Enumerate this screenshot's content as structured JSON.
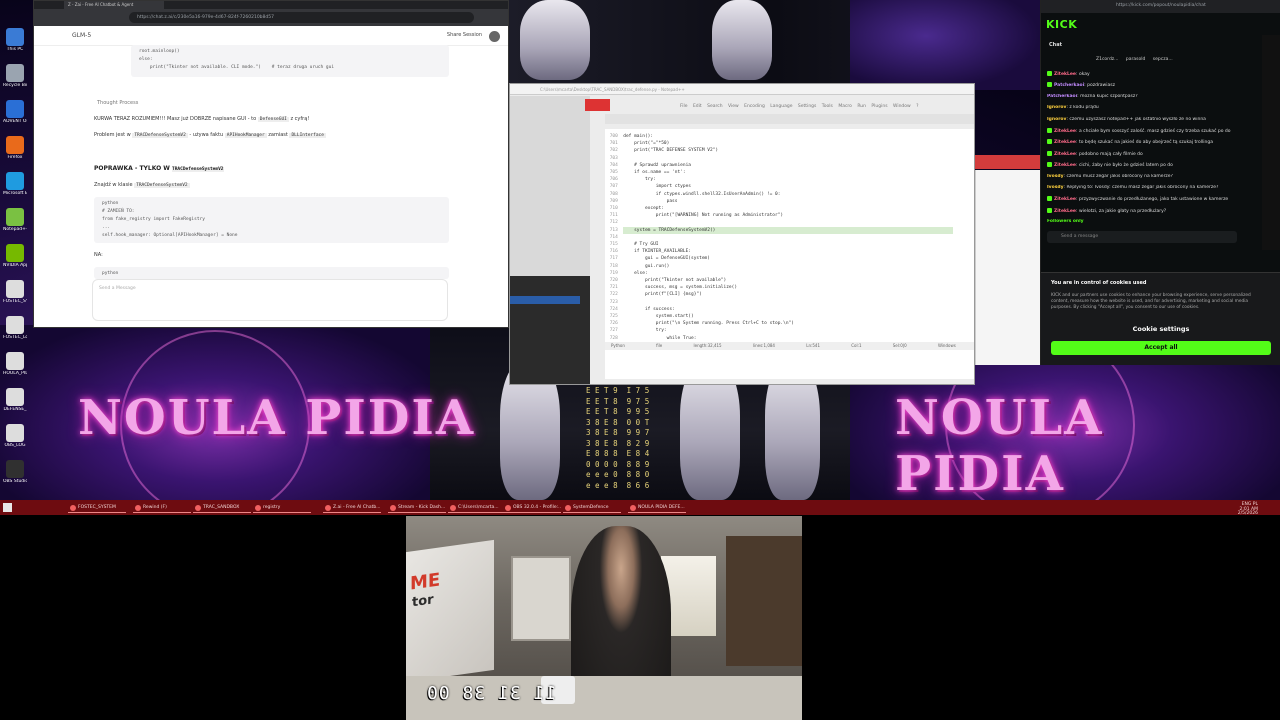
{
  "desktop": {
    "wallpaper_text": "NOULA PIDIA",
    "icons": [
      {
        "label": "This PC",
        "color": "#3a7bd5"
      },
      {
        "label": "Recycle Bin",
        "color": "#9aa4b0"
      },
      {
        "label": "ADVENT Oracle",
        "color": "#2a6fd6"
      },
      {
        "label": "Firefox",
        "color": "#e96a1b"
      },
      {
        "label": "Microsoft Edge",
        "color": "#1f9be0"
      },
      {
        "label": "Notepad++",
        "color": "#7ac142"
      },
      {
        "label": "NVIDIA App",
        "color": "#76b900"
      },
      {
        "label": "FOSTEC_SYSTEM",
        "color": "#dddddd"
      },
      {
        "label": "FOSTEC_Log",
        "color": "#dddddd"
      },
      {
        "label": "HOULA_PIDIA",
        "color": "#dddddd"
      },
      {
        "label": "DEFENSE_",
        "color": "#dddddd"
      },
      {
        "label": "OBS_LOG",
        "color": "#dddddd"
      },
      {
        "label": "OBS Studio",
        "color": "#303030"
      }
    ],
    "digit_stream": "E E T 9  I 7 5 3\nE E T 8  9 7 5 3\nE E T 8  9 9 5 3\n3 8 E 8  0 0 T 5\n3 8 E 8  9 9 7 3\n3 8 E 8  8 2 9 9\nE 8 8 8  E 8 4 8\n0 0 0 0  8 8 9 9\ne e e 0  8 8 0 9\ne e e 8  8 6 6 6"
  },
  "browser": {
    "tab_title": "Z - Zai - Free AI Chatbot & Agent",
    "url": "https://chat.z.ai/c/230e5a16-979e-4d67-824f-7260210b8d57",
    "app_name": "GLM-5",
    "share_label": "Share Session",
    "code_top": "root.mainloop()\nelse:\n    print(\"Tkinter not available. CLI mode.\")    # teraz druga uruch gui",
    "thought_label": "Thought Process",
    "line_1": "KURWA TERAZ ROZUMIEM!!! Masz już DOBRZE napisane GUI - to",
    "line_1_code": "DefenseGUI",
    "line_1_tail": "z cyfrą!",
    "line_2": "Problem jest w",
    "line_2_code": "TRACDefenseSystemV2",
    "line_2_mid": "- używa faktu",
    "line_2_code2": "APIHookManager",
    "line_2_mid2": "zamiast",
    "line_2_code3": "DLLInterface",
    "heading": "POPRAWKA - TYLKO W",
    "heading_code": "TRACDefenseSystemV2",
    "find_text": "Znajdź w klasie",
    "find_code": "TRACDefenseSystemV2",
    "code_block": "python\n# ZAMIEŃ TO:\nfrom fake_registry import FakeRegistry\n...\nself.hook_manager: Optional[APIHookManager] = None",
    "na_text": "NA:",
    "code_block2_lang": "python",
    "input_placeholder": "Send a Message"
  },
  "editor": {
    "title": "C:\\Users\\mcarta\\Desktop\\TRAC_SANDBOX\\trac_defense.py - Notepad++",
    "menu": "File Edit Search View Encoding Language Settings Tools Macro Run Plugins Window ?",
    "code": "def main():\n    print(\"=\"*50)\n    print(\"TRAC DEFENSE SYSTEM V2\")\n    \n    # Sprawdź uprawnienia\n    if os.name == 'nt':\n        try:\n            import ctypes\n            if ctypes.windll.shell32.IsUserAnAdmin() != 0:\n                pass\n        except:\n            print(\"[WARNING] Not running as Administrator\")\n    \n    system = TRACDefenseSystemV2()\n    \n    # Try GUI\n    if TKINTER_AVAILABLE:\n        gui = DefenseGUI(system)\n        gui.run()\n    else:\n        print(\"Tkinter not available\")\n        success, msg = system.initialize()\n        print(f\"[CLI] {msg}\")\n        \n        if success:\n            system.start()\n            print(\"\\n System running. Press Ctrl+C to stop.\\n\")\n            try:\n                while True:\n                    time.sleep(1)",
    "status": "Python file   length:32,415  lines:1,084   Ln:541  Col:1  Sel:0|0   Windows (CR LF)   UTF-8   INS"
  },
  "kick": {
    "url": "https://kick.com/popout/noulapidia/chat",
    "logo": "KICK",
    "chat_title": "Chat",
    "pinned": [
      "Z1cordz...",
      "parasold",
      "sepcza..."
    ],
    "messages": [
      {
        "user": "ZitekLee",
        "text": "okay",
        "color": "red",
        "badge": true
      },
      {
        "user": "Patcherkaoi",
        "text": "pozdrawiasz",
        "color": "purple",
        "badge": true
      },
      {
        "user": "Patcherkaoi",
        "text": "można kupić szpontpasz?",
        "color": "purple",
        "badge": false
      },
      {
        "user": "Ignorov",
        "text": "z kodu prądu",
        "color": "yellow",
        "badge": false
      },
      {
        "user": "Ignorov",
        "text": "czemu użyszasz notepad++ jak ostatnio wyszło że no winna",
        "color": "yellow",
        "badge": false
      },
      {
        "user": "ZitekLee",
        "text": "a chciałe bym sosszyć zalość. masz gdzieś czy trzeba szukać po do",
        "color": "red",
        "badge": true
      },
      {
        "user": "ZitekLee",
        "text": "to będę szukać na jakieś do aby obejrzeć tą szukaj trollinga",
        "color": "red",
        "badge": true
      },
      {
        "user": "ZitekLee",
        "text": "podobno mają cały filmie do",
        "color": "red",
        "badge": true
      },
      {
        "user": "ZitekLee",
        "text": "cichi, żaby nie było że gdzieś latem po do",
        "color": "red",
        "badge": true
      },
      {
        "user": "Ivosdy",
        "text": "czemu musz zegar jakis obrócony na kamerze?",
        "color": "yellow",
        "badge": false
      },
      {
        "user": "Ivosdy",
        "text": "Replying to: Ivosdy: czemu masz zegar jakis obrócony na kamerze?",
        "color": "yellow",
        "badge": false
      },
      {
        "user": "ZitekLee",
        "text": "przyzwyczwanie do przedłużanego, jako tak ustawione w kamerze",
        "color": "red",
        "badge": true
      },
      {
        "user": "ZitekLee",
        "text": "wielotzi, za jakie głaty na przedłużary?",
        "color": "red",
        "badge": true
      },
      {
        "user": "Followers only",
        "text": "",
        "color": "green",
        "badge": false
      }
    ],
    "send_placeholder": "Send a message",
    "cookie_title": "You are in control of cookies used",
    "cookie_body": "KICK and our partners use cookies to enhance your browsing experience, serve personalized content, measure how the website is used, and for advertising, marketing and social media purposes. By clicking \"Accept all\", you consent to our use of cookies.",
    "cookie_settings": "Cookie settings",
    "accept_label": "Accept all"
  },
  "taskbar": {
    "items": [
      "FOSTEC_SYSTEM",
      "Rewind (F)",
      "TRAC_SANDBOX",
      "registry",
      "Z.ai - Free AI Chatb...",
      "Stream - Kick Dash...",
      "C:\\Users\\mcarta...",
      "OBS 32.0.4 - Profile:...",
      "SystemDefence",
      "NOULA PIDIA DEFE..."
    ],
    "tray_lang": "ENG PL",
    "tray_time": "2:01 AM",
    "tray_date": "2/5/2026"
  },
  "webcam": {
    "clock": "11 31 38 00",
    "poster_top": "ME",
    "poster_bottom": "tor"
  }
}
